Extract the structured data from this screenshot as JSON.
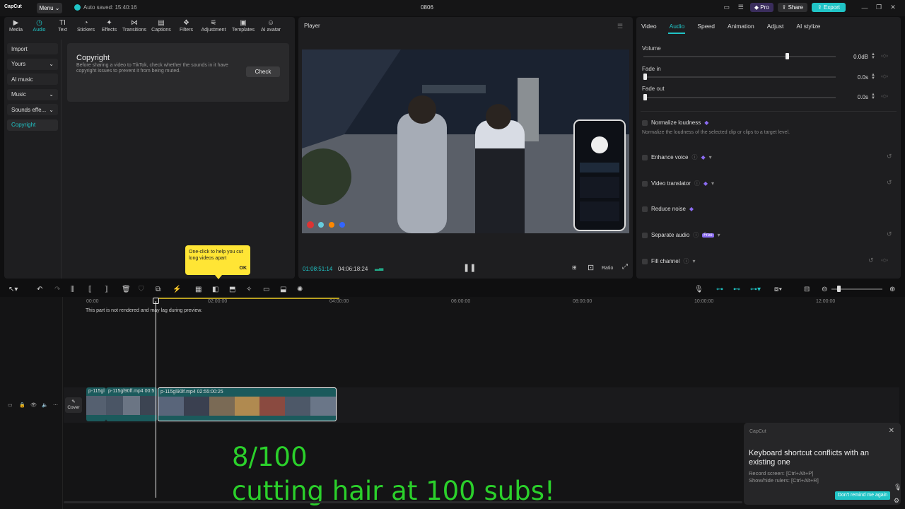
{
  "titlebar": {
    "logo": "CapCut",
    "menu": "Menu",
    "autosave": "Auto saved: 15:40:16",
    "project": "0806",
    "pro": "Pro",
    "share": "Share",
    "export": "Export"
  },
  "toolbar": [
    "Media",
    "Audio",
    "Text",
    "Stickers",
    "Effects",
    "Transitions",
    "Captions",
    "Filters",
    "Adjustment",
    "Templates",
    "AI avatar"
  ],
  "sidenav": [
    {
      "label": "Import",
      "chev": ""
    },
    {
      "label": "Yours",
      "chev": "⌄"
    },
    {
      "label": "AI music",
      "chev": ""
    },
    {
      "label": "Music",
      "chev": "⌄"
    },
    {
      "label": "Sounds effe...",
      "chev": "⌄"
    },
    {
      "label": "Copyright",
      "chev": ""
    }
  ],
  "copyright": {
    "title": "Copyright",
    "desc": "Before sharing a video to TikTok, check whether the sounds in it have copyright issues to prevent it from being muted.",
    "check": "Check"
  },
  "tooltip": {
    "text": "One-click to help you cut long videos apart",
    "ok": "OK"
  },
  "player": {
    "title": "Player",
    "current": "01:08:51:14",
    "total": "04:06:18:24",
    "ratio": "Ratio"
  },
  "props": {
    "tabs": [
      "Video",
      "Audio",
      "Speed",
      "Animation",
      "Adjust",
      "AI stylize"
    ],
    "volume": {
      "label": "Volume",
      "value": "0.0dB",
      "level": 0.74
    },
    "fade_in": {
      "label": "Fade in",
      "value": "0.0s"
    },
    "fade_out": {
      "label": "Fade out",
      "value": "0.0s"
    },
    "normalize": "Normalize loudness",
    "normalize_desc": "Normalize the loudness of the selected clip or clips to a target level.",
    "enhance": "Enhance voice",
    "translator": "Video translator",
    "reduce": "Reduce noise",
    "separate": "Separate audio",
    "free": "Free",
    "fill": "Fill channel"
  },
  "timeline": {
    "ruler": [
      "00:00",
      "02:00:00",
      "04:00:00",
      "06:00:00",
      "08:00:00",
      "10:00:00",
      "12:00:00"
    ],
    "warning": "This part is not rendered and may lag during preview.",
    "cover": "Cover",
    "clips": [
      {
        "label": "p-115gl"
      },
      {
        "label": "p-115gl90lf.mp4  00:5"
      },
      {
        "label": "p-115gl90lf.mp4  02:55:00:25"
      }
    ]
  },
  "overlay": {
    "line1": "8/100",
    "line2": "cutting hair at 100 subs!"
  },
  "toast": {
    "app": "CapCut",
    "title": "Keyboard shortcut conflicts with an existing one",
    "line1": "Record screen: [Ctrl+Alt+P]",
    "line2": "Show/hide rulers: [Ctrl+Alt+R]",
    "button": "Don't remind me again"
  },
  "colors": {
    "accent": "#20c4c6",
    "green_text": "#2bd02b",
    "tooltip": "#ffe535"
  }
}
